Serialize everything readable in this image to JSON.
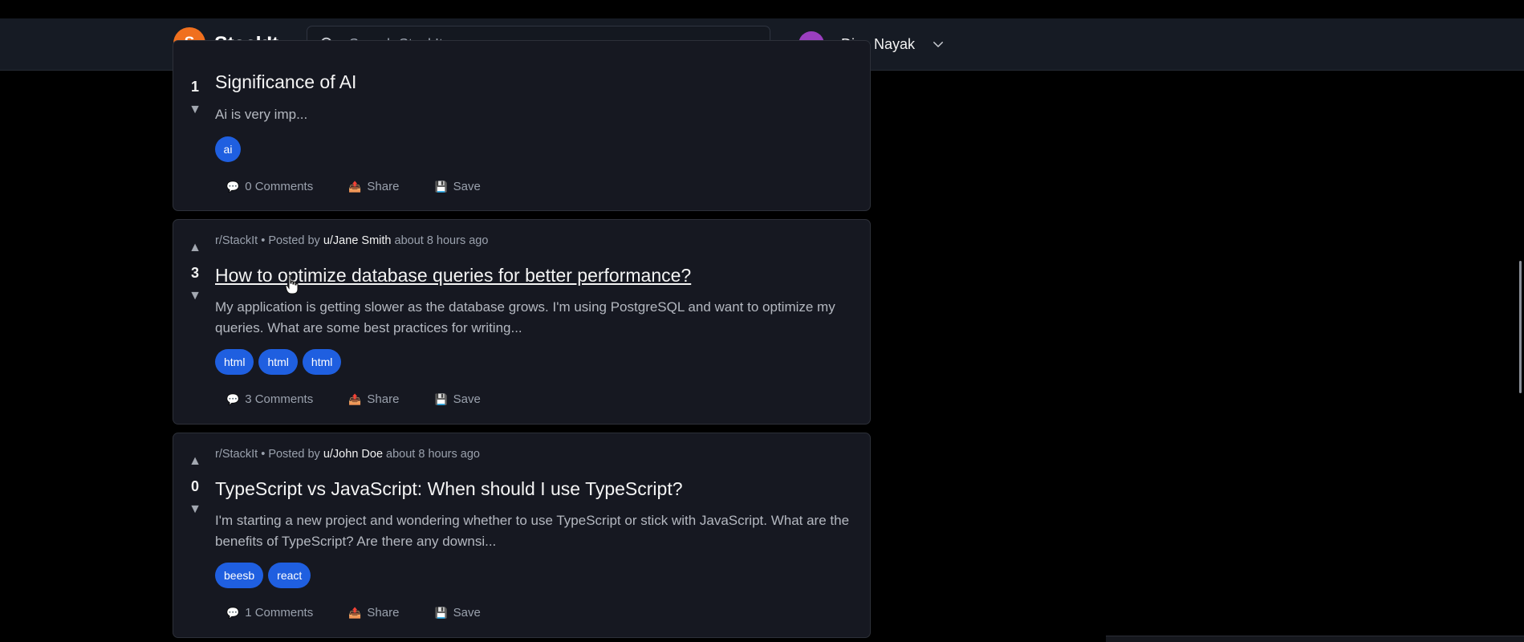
{
  "app": {
    "logo_letter": "S",
    "brand": "StackIt"
  },
  "search": {
    "placeholder": "Search StackIt",
    "value": ""
  },
  "user": {
    "initial": "D",
    "name": "Diya Nayak",
    "avatar_color": "#9b3fc0"
  },
  "colors": {
    "accent": "#f0701e",
    "tag": "#1f5fe0",
    "card_bg": "#161821",
    "page_bg": "#000000"
  },
  "posts": [
    {
      "score": "1",
      "title": "Significance of AI",
      "excerpt": "Ai is very imp...",
      "tags": [
        "ai"
      ],
      "comments": "0 Comments",
      "share": "Share",
      "save": "Save"
    },
    {
      "community": "r/StackIt",
      "posted_by": "• Posted by",
      "author": "u/Jane Smith",
      "time": "about 8 hours ago",
      "score": "3",
      "title": "How to optimize database queries for better performance?",
      "excerpt": "My application is getting slower as the database grows. I'm using PostgreSQL and want to optimize my queries. What are some best practices for writing...",
      "tags": [
        "html",
        "html",
        "html"
      ],
      "comments": "3 Comments",
      "share": "Share",
      "save": "Save"
    },
    {
      "community": "r/StackIt",
      "posted_by": "• Posted by",
      "author": "u/John Doe",
      "time": "about 8 hours ago",
      "score": "0",
      "title": "TypeScript vs JavaScript: When should I use TypeScript?",
      "excerpt": "I'm starting a new project and wondering whether to use TypeScript or stick with JavaScript. What are the benefits of TypeScript? Are there any downsi...",
      "tags": [
        "beesb",
        "react"
      ],
      "comments": "1 Comments",
      "share": "Share",
      "save": "Save"
    }
  ],
  "icons": {
    "upvote": "upvote-icon",
    "downvote": "downvote-icon",
    "comment": "comment-icon",
    "share": "share-icon",
    "save": "save-icon",
    "search": "search-icon",
    "chevron": "chevron-down-icon"
  }
}
